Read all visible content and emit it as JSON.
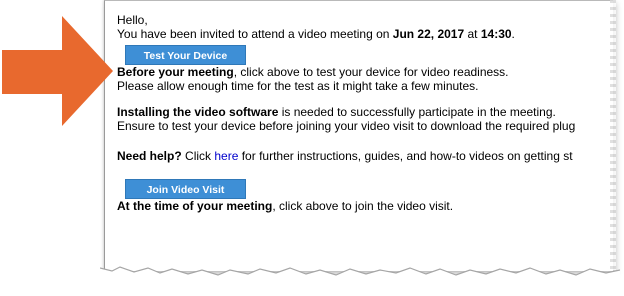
{
  "email": {
    "greeting": "Hello,",
    "invite_prefix": "You have been invited to attend a video meeting on ",
    "invite_date": "Jun 22, 2017",
    "invite_mid": " at ",
    "invite_time": "14:30",
    "invite_suffix": ".",
    "test_button_label": "Test Your Device",
    "before_bold": "Before your meeting",
    "before_rest": ", click above to test your device for video readiness.",
    "allow_time": "Please allow enough time for the test as it might take a few minutes.",
    "install_bold": "Installing the video software",
    "install_rest": " is needed to successfully participate in the meeting.",
    "ensure_text": "Ensure to test your device before joining your video visit to download the required plug",
    "help_bold": "Need help?",
    "help_click": " Click ",
    "help_link": "here",
    "help_rest": " for further instructions, guides, and how-to videos on getting st",
    "join_button_label": "Join Video Visit",
    "time_bold": "At the time of your meeting",
    "time_rest": ", click above to join the video visit."
  },
  "colors": {
    "arrow": "#e8692e",
    "button": "#3e8fd6",
    "link": "#0000cc"
  },
  "icons": {
    "arrow": "arrow-right-icon"
  }
}
